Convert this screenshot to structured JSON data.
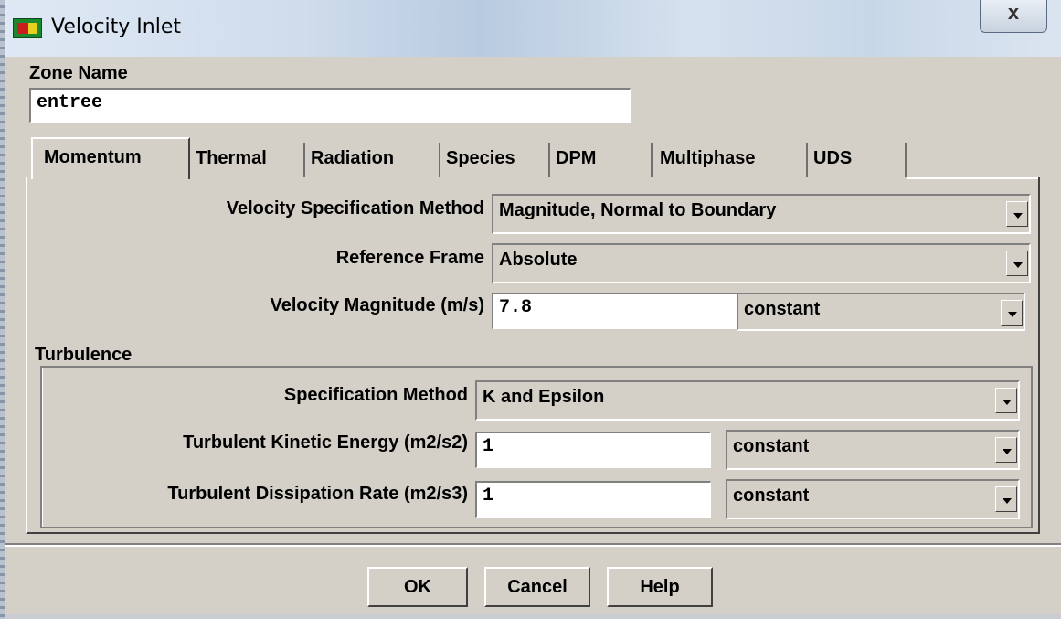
{
  "window": {
    "title": "Velocity Inlet",
    "close_label": "x"
  },
  "zone": {
    "label": "Zone Name",
    "value": "entree"
  },
  "tabs": [
    {
      "label": "Momentum",
      "active": true
    },
    {
      "label": "Thermal"
    },
    {
      "label": "Radiation"
    },
    {
      "label": "Species"
    },
    {
      "label": "DPM"
    },
    {
      "label": "Multiphase"
    },
    {
      "label": "UDS"
    }
  ],
  "momentum": {
    "velocity_spec": {
      "label": "Velocity Specification Method",
      "value": "Magnitude, Normal to Boundary"
    },
    "reference_frame": {
      "label": "Reference Frame",
      "value": "Absolute"
    },
    "velocity_magnitude": {
      "label": "Velocity Magnitude (m/s)",
      "value": "7.8",
      "profile": "constant"
    }
  },
  "turbulence": {
    "heading": "Turbulence",
    "spec_method": {
      "label": "Specification Method",
      "value": "K and Epsilon"
    },
    "kinetic_energy": {
      "label": "Turbulent Kinetic Energy (m2/s2)",
      "value": "1",
      "profile": "constant"
    },
    "dissipation_rate": {
      "label": "Turbulent Dissipation Rate (m2/s3)",
      "value": "1",
      "profile": "constant"
    }
  },
  "buttons": {
    "ok": "OK",
    "cancel": "Cancel",
    "help": "Help"
  }
}
